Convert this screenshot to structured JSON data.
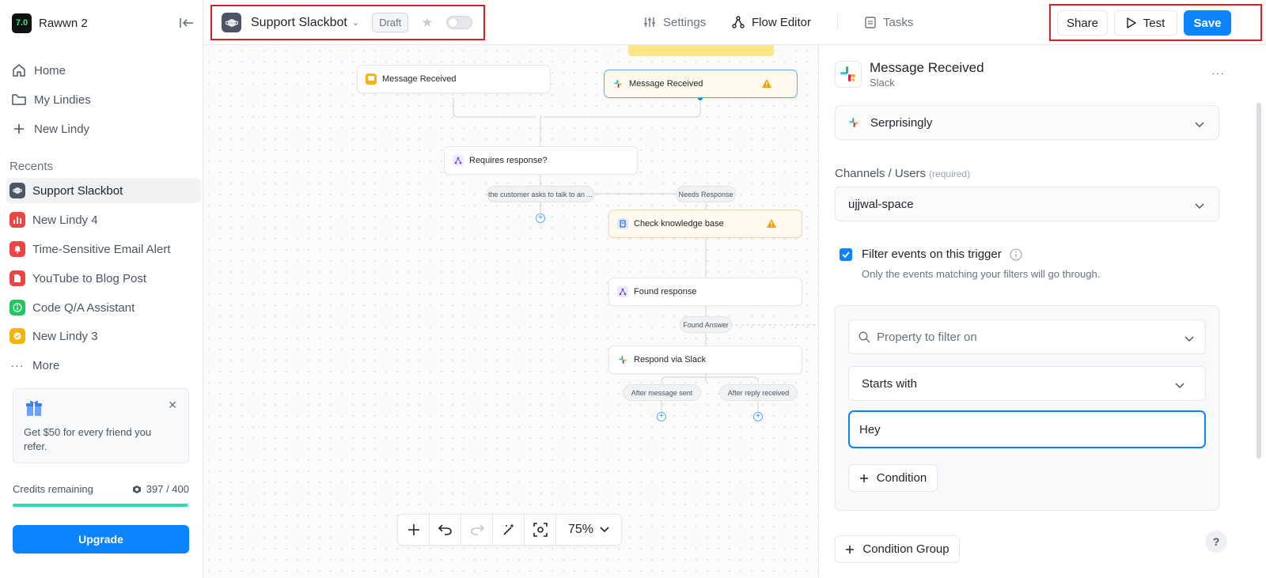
{
  "workspace": {
    "logo_text": "7.0",
    "name": "Rawwn 2"
  },
  "nav": {
    "home": "Home",
    "my_lindies": "My Lindies",
    "new_lindy": "New Lindy"
  },
  "recents": {
    "label": "Recents",
    "items": [
      {
        "label": "Support Slackbot",
        "color": "#4b5563"
      },
      {
        "label": "New Lindy 4",
        "color": "#ef4444"
      },
      {
        "label": "Time-Sensitive Email Alert",
        "color": "#ef4444"
      },
      {
        "label": "YouTube to Blog Post",
        "color": "#ef4444"
      },
      {
        "label": "Code Q/A Assistant",
        "color": "#22c55e"
      },
      {
        "label": "New Lindy 3",
        "color": "#f5b40b"
      }
    ],
    "more": "More"
  },
  "promo": {
    "text": "Get $50 for every friend you refer."
  },
  "credits": {
    "label": "Credits remaining",
    "value": "397 / 400",
    "fraction": 0.9925
  },
  "upgrade_label": "Upgrade",
  "topbar": {
    "agent_name": "Support Slackbot",
    "status": "Draft",
    "tabs": [
      {
        "label": "Settings",
        "icon": "sliders-icon"
      },
      {
        "label": "Flow Editor",
        "icon": "flow-icon"
      },
      {
        "label": "Tasks",
        "icon": "clipboard-icon"
      }
    ],
    "share": "Share",
    "test": "Test",
    "save": "Save"
  },
  "flow": {
    "nodes": {
      "trigger_a": "Message Received",
      "trigger_b": "Message Received",
      "requires": "Requires response?",
      "check_kb": "Check knowledge base",
      "found": "Found response",
      "respond": "Respond via Slack"
    },
    "labels": {
      "talk": "the customer asks to talk to an ...",
      "needs": "Needs Response",
      "found_answer": "Found Answer",
      "after_sent": "After message sent",
      "after_reply": "After reply received"
    },
    "zoom": "75%"
  },
  "panel": {
    "title": "Message Received",
    "subtitle": "Slack",
    "workspace_select": "Serprisingly",
    "channels_label": "Channels / Users",
    "channels_required": "(required)",
    "channels_value": "ujjwal-space",
    "filter_checkbox": "Filter events on this trigger",
    "filter_hint": "Only the events matching your filters will go through.",
    "property_placeholder": "Property to filter on",
    "operator": "Starts with",
    "value": "Hey",
    "condition_btn": "Condition",
    "condition_group_btn": "Condition Group",
    "help": "?"
  }
}
